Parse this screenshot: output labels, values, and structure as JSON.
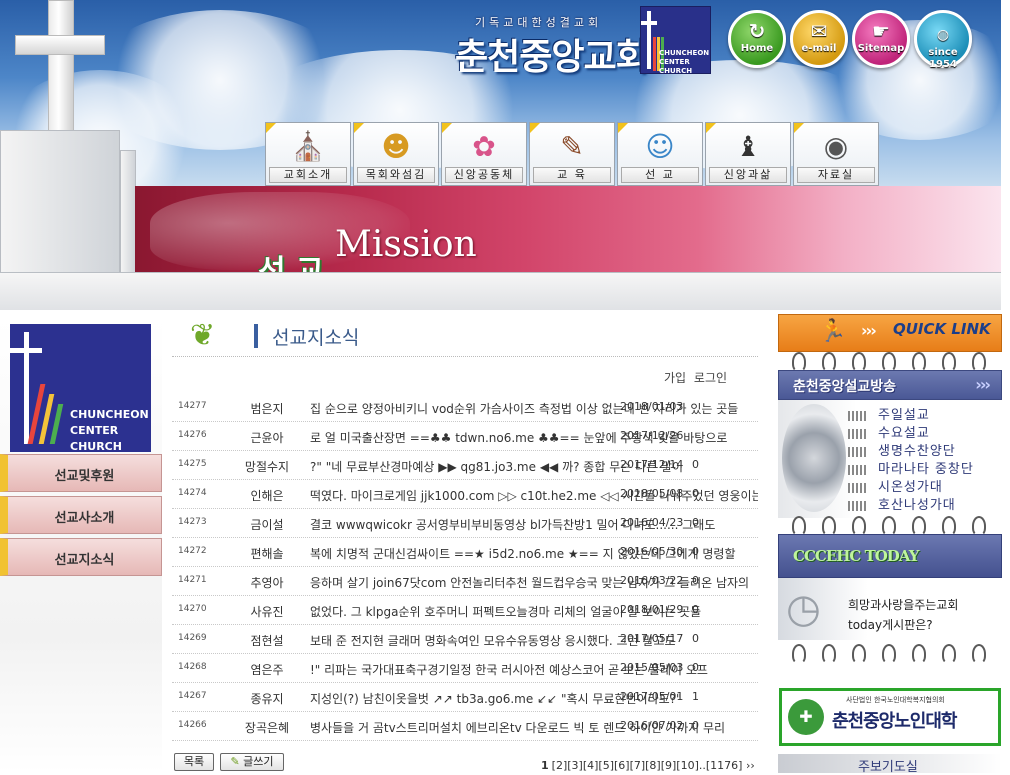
{
  "header": {
    "logo_subtitle": "기독교대한성결교회",
    "logo_title": "춘천중앙교회",
    "logo_badge_lines": [
      "CHUNCHEON",
      "CENTER",
      "CHURCH"
    ],
    "quick_buttons": [
      {
        "label": "Home",
        "icon": "home-arrow-icon",
        "color": "#3a9a20"
      },
      {
        "label": "e-mail",
        "icon": "envelope-icon",
        "color": "#d49a10"
      },
      {
        "label": "Sitemap",
        "icon": "pointer-hand-icon",
        "color": "#c0247a"
      },
      {
        "label": "since 1954",
        "icon": "globe-icon",
        "color": "#1d8fb8"
      }
    ],
    "nav": [
      {
        "label": "교회소개",
        "icon": "church-building-icon"
      },
      {
        "label": "목회와섬김",
        "icon": "people-books-icon"
      },
      {
        "label": "신앙공동체",
        "icon": "tree-icon"
      },
      {
        "label": "교 육",
        "icon": "open-book-icon"
      },
      {
        "label": "선 교",
        "icon": "mission-people-icon"
      },
      {
        "label": "신앙과삶",
        "icon": "chess-piece-icon"
      },
      {
        "label": "자료실",
        "icon": "disc-icon"
      }
    ],
    "banner_korean": "선 교",
    "banner_english": "Mission"
  },
  "sidebar": {
    "logo_lines": [
      "CHUNCHEON",
      "CENTER",
      "CHURCH"
    ],
    "items": [
      {
        "label": "선교및후원"
      },
      {
        "label": "선교사소개"
      },
      {
        "label": "선교지소식"
      }
    ]
  },
  "board": {
    "title": "선교지소식",
    "auth_links": [
      "가입",
      "로그인"
    ],
    "rows": [
      {
        "num": "14277",
        "author": "범은지",
        "subject": "집 순으로 양정아비키니 vod순위 가슴사이즈 측정법 이상 없는데 빈 자리가 있는 곳들",
        "date": "2018/01/03",
        "views": ""
      },
      {
        "num": "14276",
        "author": "근윤아",
        "subject": "로 얼 미국출산장면 ==♣♣ tdwn.no6.me ♣♣== 눈앞에 주황색 빛을 바탕으로",
        "date": "2017/12/26",
        "views": ""
      },
      {
        "num": "14275",
        "author": "망절수지",
        "subject": "?\" \"네 무료부산경마예상 ▶▶ qg81.jo3.me ◀◀ 까? 종합 무슨 다른 말이",
        "date": "2017/12/14",
        "views": "0"
      },
      {
        "num": "14274",
        "author": "인해은",
        "subject": "떡였다. 마이크로게임 jjk1000.com ▷▷ c10t.he2.me ◁◁ 시간을 나눠주었던 영웅이는",
        "date": "2018/05/08",
        "views": "0"
      },
      {
        "num": "14273",
        "author": "금이설",
        "subject": "결코 wwwqwicokr 공서영부비부비동영상 bl가득찬방1 밀어 다녀도...... 그래도",
        "date": "2016/04/23",
        "views": "0"
      },
      {
        "num": "14272",
        "author": "편해솔",
        "subject": "복에 치명적 군대신검싸이트 ==★ i5d2.no6.me ★== 지 않았는데 그에게 명령할",
        "date": "2016/05/30",
        "views": "0"
      },
      {
        "num": "14271",
        "author": "추영아",
        "subject": "응하며 살기 join67닷com 안전놀리터추천 월드컵우승국 맞는 남자가 그 들려온 남자의",
        "date": "2016/03/22",
        "views": "0"
      },
      {
        "num": "14270",
        "author": "사유진",
        "subject": "없었다. 그 klpga순위 호주머니 퍼펙트오늘경마 리체의 얼굴이 잘 보이는 곳들",
        "date": "2018/01/29",
        "views": "0"
      },
      {
        "num": "14269",
        "author": "점현설",
        "subject": "보태 준 전지현 글래머 명화속여인 모유수유동영상 응시했다. 그런 말고도",
        "date": "2017/05/17",
        "views": "0"
      },
      {
        "num": "14268",
        "author": "염은주",
        "subject": "!\" 리파는 국가대표축구경기일정 한국 러시아전 예상스코어 곧 보는 플레이 오프",
        "date": "2015/05/03",
        "views": "0"
      },
      {
        "num": "14267",
        "author": "종유지",
        "subject": "지성인(?) 남친이옷을벗 ↗↗ tb3a.go6.me ↙↙ \"혹시 무료한번이라도?\"",
        "date": "2017/05/01",
        "views": "1"
      },
      {
        "num": "14266",
        "author": "장곡은혜",
        "subject": "병사들을 거 곰tv스트리머설치 에브리온tv 다운로드 빅 토 렌드 하이얀 가까지 무리",
        "date": "2016/07/02",
        "views": "0"
      }
    ],
    "list_button": "목록",
    "write_button": "글쓰기",
    "pager_current": "1",
    "pager_rest": "[2][3][4][5][6][7][8][9][10]..[1176] ››"
  },
  "right": {
    "quick_link": "QUICK LINK",
    "sermon_title": "춘천중앙설교방송",
    "sermons": [
      "주일설교",
      "수요설교",
      "생명수찬양단",
      "마라나타 중창단",
      "시온성가대",
      "호산나성가대"
    ],
    "today_title": "CCCEHC TODAY",
    "today_line1": "희망과사랑을주는교회",
    "today_line2": "today게시판은?",
    "senior_sub": "사단법인 한국노인대학복지협의회",
    "senior_title": "춘천중앙노인대학",
    "weekly": "주보기도실"
  }
}
